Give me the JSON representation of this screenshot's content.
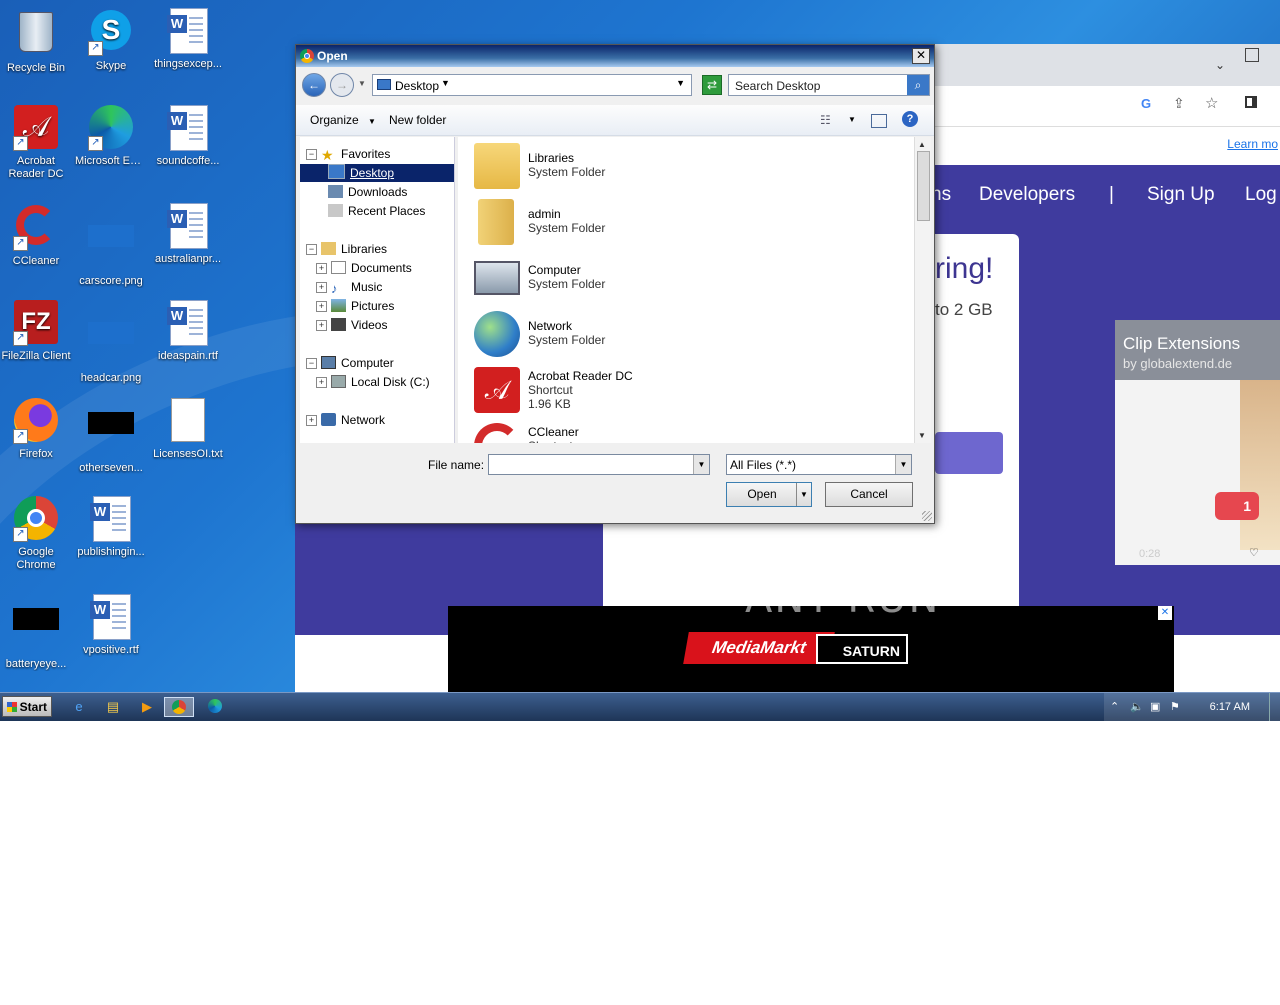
{
  "desktop": {
    "icons": [
      {
        "label": "Recycle Bin"
      },
      {
        "label": "Skype"
      },
      {
        "label": "thingsexcep..."
      },
      {
        "label": "Acrobat Reader DC"
      },
      {
        "label": "Microsoft Edge"
      },
      {
        "label": "soundcoffe..."
      },
      {
        "label": "CCleaner"
      },
      {
        "label": "carscore.png"
      },
      {
        "label": "australianpr..."
      },
      {
        "label": "FileZilla Client"
      },
      {
        "label": "headcar.png"
      },
      {
        "label": "ideaspain.rtf"
      },
      {
        "label": "Firefox"
      },
      {
        "label": "otherseven..."
      },
      {
        "label": "LicensesOI.txt"
      },
      {
        "label": "Google Chrome"
      },
      {
        "label": "publishingin..."
      },
      {
        "label": "batteryeye..."
      },
      {
        "label": "vpositive.rtf"
      }
    ]
  },
  "browser": {
    "learn_more": "Learn mo",
    "nav": [
      "ns",
      "Developers",
      "|",
      "Sign Up",
      "Log"
    ],
    "card_title": "ring!",
    "card_sub": "to 2 GB",
    "clip_title": "Clip Extensions",
    "clip_by": "by globalextend.de",
    "clip_badge": "1",
    "clip_time": "0:28",
    "ad_brand1": "MediaMarkt",
    "ad_brand2": "SATURN",
    "watermark": "ANY RUN"
  },
  "dialog": {
    "title": "Open",
    "close": "✕",
    "address": "Desktop",
    "search_placeholder": "Search Desktop",
    "toolbar": {
      "organize": "Organize",
      "new_folder": "New folder"
    },
    "tree": {
      "favorites": "Favorites",
      "desktop": "Desktop",
      "downloads": "Downloads",
      "recent": "Recent Places",
      "libraries": "Libraries",
      "documents": "Documents",
      "music": "Music",
      "pictures": "Pictures",
      "videos": "Videos",
      "computer": "Computer",
      "localdisk": "Local Disk (C:)",
      "network": "Network"
    },
    "files": [
      {
        "name": "Libraries",
        "type": "System Folder"
      },
      {
        "name": "admin",
        "type": "System Folder"
      },
      {
        "name": "Computer",
        "type": "System Folder"
      },
      {
        "name": "Network",
        "type": "System Folder"
      },
      {
        "name": "Acrobat Reader DC",
        "type": "Shortcut",
        "size": "1.96 KB"
      },
      {
        "name": "CCleaner",
        "type": "Shortcut"
      }
    ],
    "filename_label": "File name:",
    "filename_value": "",
    "filetype": "All Files (*.*)",
    "open_btn": "Open",
    "cancel_btn": "Cancel"
  },
  "taskbar": {
    "start": "Start",
    "time": "6:17 AM"
  }
}
